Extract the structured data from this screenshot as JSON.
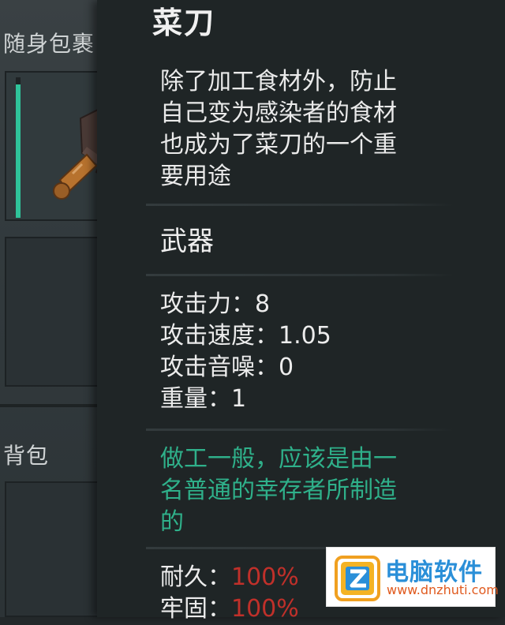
{
  "inventory": {
    "section_1_title": "随身包裹",
    "section_2_title": "背包",
    "knife_slot_durability": 0.95
  },
  "tooltip": {
    "item_name": "菜刀",
    "description_lines": [
      "除了加工食材外，防止",
      "自己变为感染者的食材",
      "也成为了菜刀的一个重",
      "要用途"
    ],
    "category": "武器",
    "stats": [
      {
        "label": "攻击力：",
        "value": "8"
      },
      {
        "label": "攻击速度：",
        "value": "1.05"
      },
      {
        "label": "攻击音噪：",
        "value": "0"
      },
      {
        "label": "重量：",
        "value": "1"
      }
    ],
    "flavor_lines": [
      "做工一般，应该是由一",
      "名普通的幸存者所制造",
      "的"
    ],
    "condition": [
      {
        "label": "耐久：",
        "value": "100%"
      },
      {
        "label": "牢固：",
        "value": "100%"
      }
    ]
  },
  "watermark": {
    "title": "电脑软件",
    "url": "www.dnzhuti.com"
  },
  "colors": {
    "durability_green": "#2fc39a",
    "flavor_green": "#2fb08a",
    "condition_red": "#c0302a",
    "tooltip_bg": "#1f2526"
  }
}
